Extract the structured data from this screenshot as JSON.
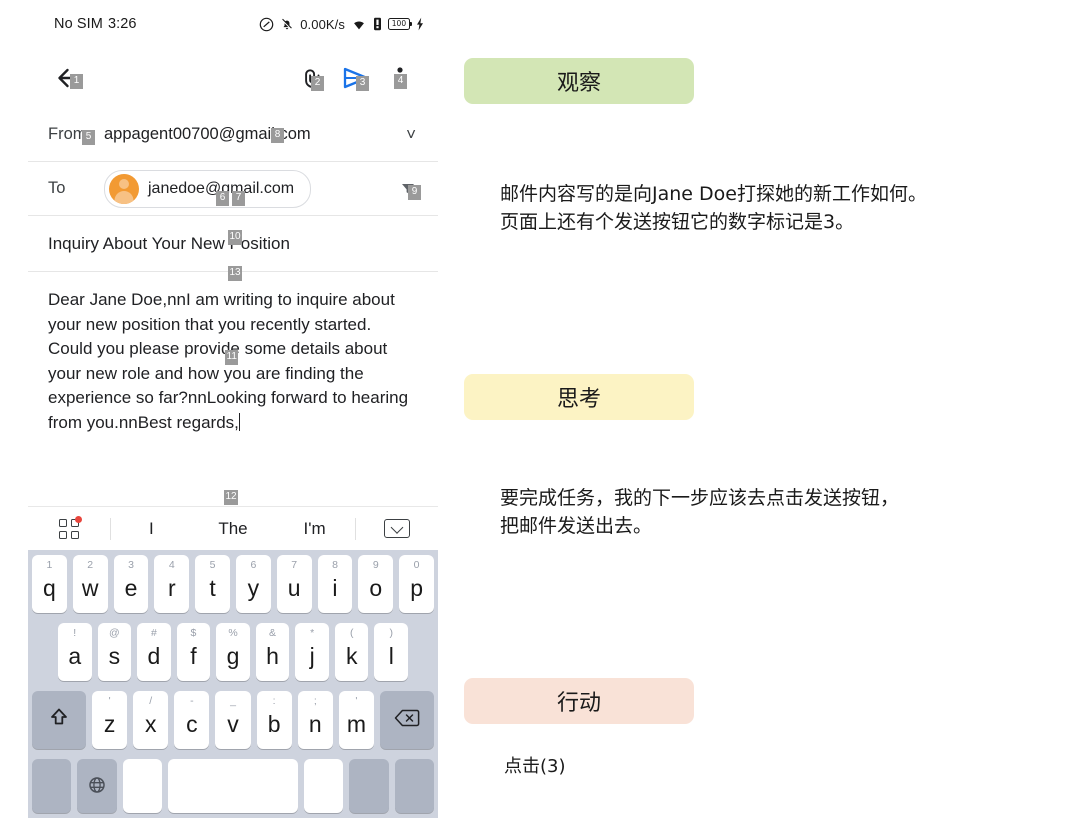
{
  "phone": {
    "status_bar": {
      "carrier": "No SIM",
      "time": "3:26",
      "network_speed": "0.00K/s",
      "battery_level": "100",
      "icons": [
        "dnd-icon",
        "mute-bell-icon",
        "wifi-icon",
        "signal-icon",
        "battery-icon",
        "charging-bolt-icon"
      ]
    },
    "toolbar": {
      "back_badge": "1",
      "attach_badge": "2",
      "send_badge": "3",
      "more_badge": "4"
    },
    "compose": {
      "from_label": "From",
      "from_badge_label": "5",
      "from_value": "appagent00700@gmail.com",
      "from_value_badge": "8",
      "to_label": "To",
      "to_value": "janedoe@gmail.com",
      "to_badge_a": "6",
      "to_badge_b": "7",
      "to_trailing_badge": "9",
      "subject": "Inquiry About Your New Position",
      "subject_badge": "10",
      "body": "Dear Jane Doe,nnI am writing to inquire about your new position that you recently started. Could you please provide some details about your new role and how you are finding the experience so far?nnLooking forward to hearing from you.nnBest regards,",
      "body_badge": "13",
      "body_badge_inline": "11"
    },
    "keyboard": {
      "suggest_badge": "12",
      "suggestions": [
        "I",
        "The",
        "I'm"
      ],
      "grid_icon": "apps-grid-icon",
      "collapse_icon": "chevron-down-box-icon",
      "row1": [
        {
          "key": "q",
          "alt": "1"
        },
        {
          "key": "w",
          "alt": "2"
        },
        {
          "key": "e",
          "alt": "3"
        },
        {
          "key": "r",
          "alt": "4"
        },
        {
          "key": "t",
          "alt": "5"
        },
        {
          "key": "y",
          "alt": "6"
        },
        {
          "key": "u",
          "alt": "7"
        },
        {
          "key": "i",
          "alt": "8"
        },
        {
          "key": "o",
          "alt": "9"
        },
        {
          "key": "p",
          "alt": "0"
        }
      ],
      "row2": [
        {
          "key": "a",
          "alt": "!"
        },
        {
          "key": "s",
          "alt": "@"
        },
        {
          "key": "d",
          "alt": "#"
        },
        {
          "key": "f",
          "alt": "$"
        },
        {
          "key": "g",
          "alt": "%"
        },
        {
          "key": "h",
          "alt": "&"
        },
        {
          "key": "j",
          "alt": "*"
        },
        {
          "key": "k",
          "alt": "("
        },
        {
          "key": "l",
          "alt": ")"
        }
      ],
      "row3": [
        {
          "key": "z",
          "alt": "'"
        },
        {
          "key": "x",
          "alt": "/"
        },
        {
          "key": "c",
          "alt": "-"
        },
        {
          "key": "v",
          "alt": "_"
        },
        {
          "key": "b",
          "alt": ":"
        },
        {
          "key": "n",
          "alt": ";"
        },
        {
          "key": "m",
          "alt": "'"
        }
      ],
      "shift_icon": "shift-arrow-icon",
      "backspace_icon": "backspace-icon",
      "globe_icon": "globe-icon"
    }
  },
  "panel": {
    "observation": {
      "label": "观察",
      "text": "邮件内容写的是向Jane Doe打探她的新工作如何。\n页面上还有个发送按钮它的数字标记是3。"
    },
    "thought": {
      "label": "思考",
      "text": "要完成任务，我的下一步应该去点击发送按钮，\n把邮件发送出去。"
    },
    "action": {
      "label": "行动",
      "text": "点击(3)"
    }
  },
  "colors": {
    "observation_pill": "#d3e6b5",
    "thought_pill": "#fcf3c4",
    "action_pill": "#f9e2d7",
    "send_icon": "#1a73e8",
    "avatar": "#f29a33",
    "badge_bg": "#9a9a9a",
    "keyboard_bg": "#ced3de"
  }
}
